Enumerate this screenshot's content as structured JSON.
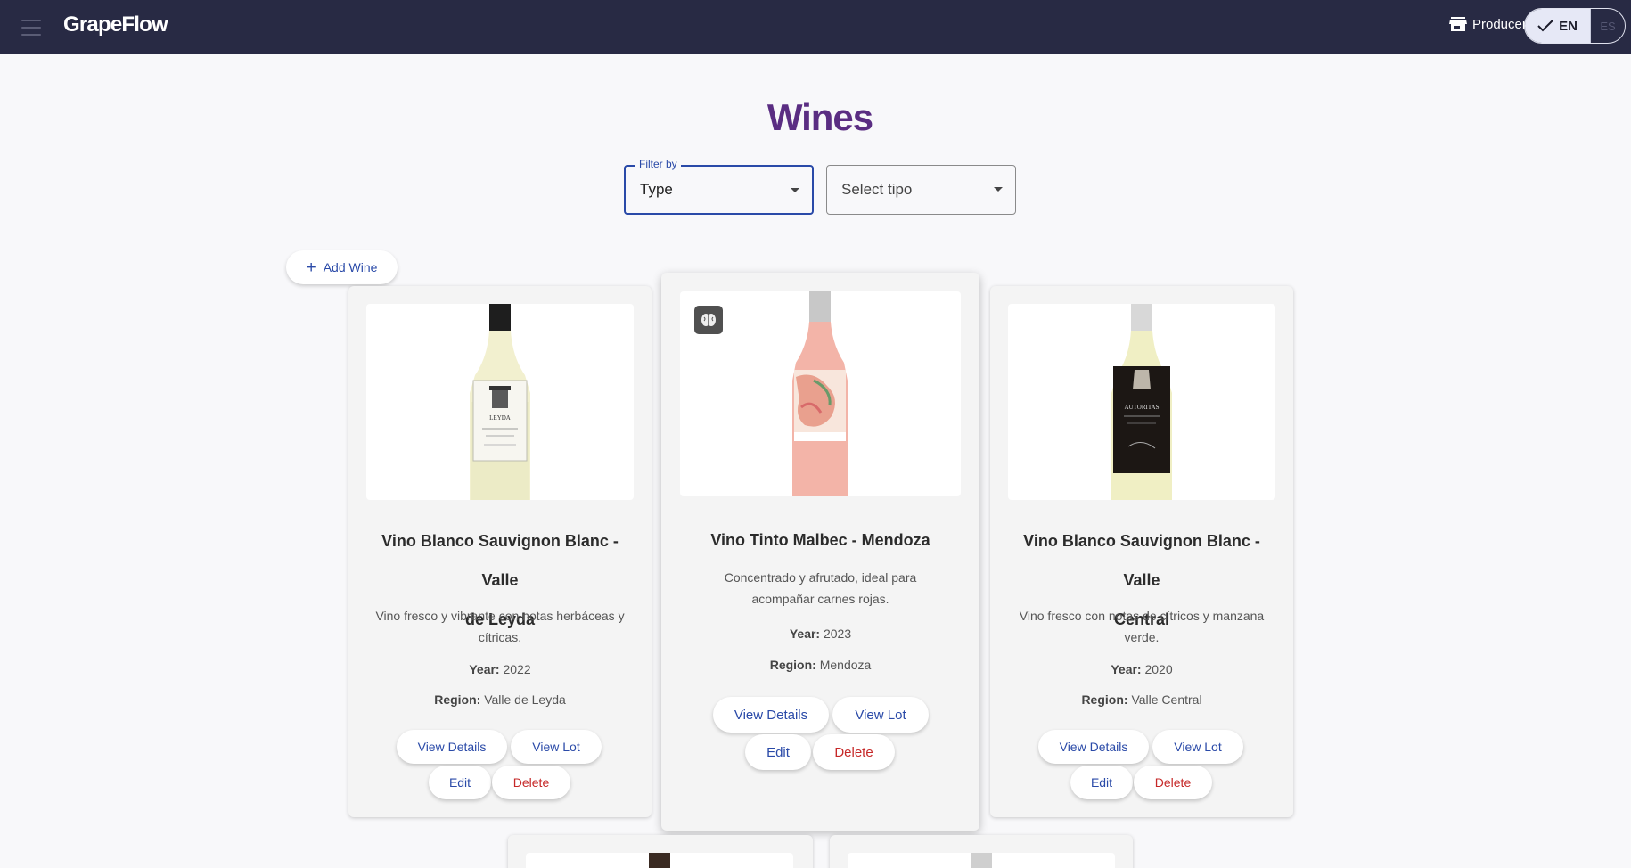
{
  "app": {
    "brand": "GrapeFlow"
  },
  "header": {
    "producer_label": "Producer",
    "lang_en": "EN",
    "lang_es": "ES"
  },
  "page": {
    "title": "Wines"
  },
  "filters": {
    "filter_by_label": "Filter by",
    "type_value": "Type",
    "tipo_placeholder": "Select tipo"
  },
  "actions": {
    "add_wine": "Add Wine"
  },
  "labels": {
    "year": "Year:",
    "region": "Region:",
    "view_details": "View Details",
    "view_lot": "View Lot",
    "edit": "Edit",
    "delete": "Delete"
  },
  "wines": [
    {
      "title_line1": "Vino Blanco Sauvignon Blanc - Valle",
      "title_line2": "de Leyda",
      "desc_line1": "Vino fresco y vibrante con notas herbáceas y",
      "desc_line2": "cítricas.",
      "year": "2022",
      "region": "Valle de Leyda",
      "label_text": "LEYDA"
    },
    {
      "title_line1": "Vino Tinto Malbec - Mendoza",
      "desc_line1": "Concentrado y afrutado, ideal para",
      "desc_line2": "acompañar carnes rojas.",
      "year": "2023",
      "region": "Mendoza"
    },
    {
      "title_line1": "Vino Blanco Sauvignon Blanc - Valle",
      "title_line2": "Central",
      "desc_line1": "Vino fresco con notas de cítricos y manzana",
      "desc_line2": "verde.",
      "year": "2020",
      "region": "Valle Central",
      "label_text": "AUTORITAS"
    }
  ],
  "colors": {
    "topbar": "#282a44",
    "title": "#5a2d82",
    "accent_blue": "#2a4aa8",
    "danger_red": "#c62828"
  }
}
